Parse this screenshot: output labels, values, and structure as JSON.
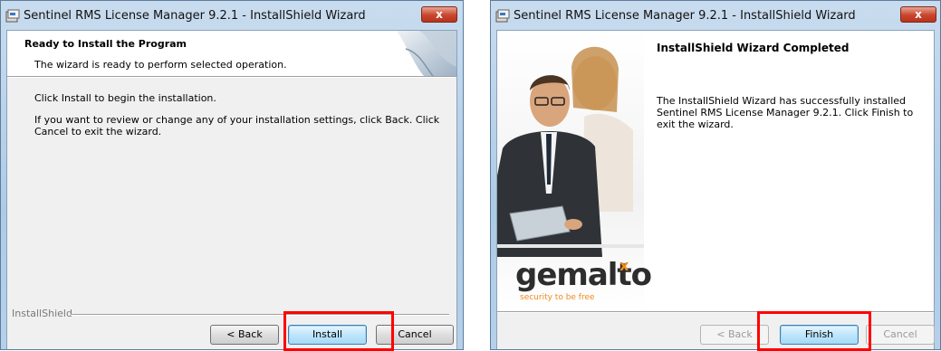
{
  "window1": {
    "title": "Sentinel RMS License Manager 9.2.1 - InstallShield Wizard",
    "close_label": "x",
    "header": {
      "title": "Ready to Install the Program",
      "subtitle": "The wizard is ready to perform selected operation."
    },
    "body": {
      "line1": "Click Install to begin the installation.",
      "line2": "If you want to review or change any of your installation settings, click Back. Click Cancel to exit the wizard."
    },
    "brand": "InstallShield",
    "buttons": {
      "back": "< Back",
      "install": "Install",
      "cancel": "Cancel"
    }
  },
  "window2": {
    "title": "Sentinel RMS License Manager 9.2.1 - InstallShield Wizard",
    "close_label": "x",
    "heading": "InstallShield Wizard Completed",
    "message": "The InstallShield Wizard has successfully installed Sentinel RMS License Manager 9.2.1. Click Finish to exit the wizard.",
    "logo": {
      "name": "gemalto",
      "mark": "x",
      "tagline": "security to be free"
    },
    "buttons": {
      "back": "< Back",
      "finish": "Finish",
      "cancel": "Cancel"
    }
  },
  "colors": {
    "highlight": "#ff0000",
    "brand_orange": "#f08a1c",
    "close_red": "#c9452b"
  }
}
